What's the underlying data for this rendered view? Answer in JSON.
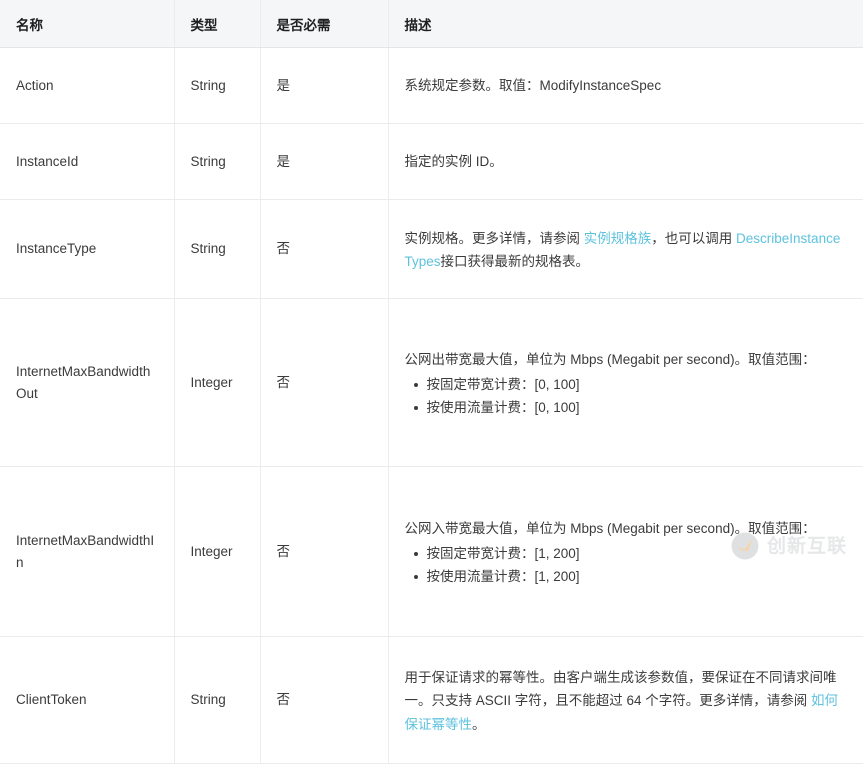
{
  "table": {
    "headers": [
      {
        "id": "name",
        "label": "名称"
      },
      {
        "id": "type",
        "label": "类型"
      },
      {
        "id": "required",
        "label": "是否必需"
      },
      {
        "id": "description",
        "label": "描述"
      }
    ],
    "rows": [
      {
        "name": "Action",
        "type": "String",
        "required": "是",
        "description": {
          "text": "系统规定参数。取值：ModifyInstanceSpec"
        }
      },
      {
        "name": "InstanceId",
        "type": "String",
        "required": "是",
        "description": {
          "text": "指定的实例 ID。"
        }
      },
      {
        "name": "InstanceType",
        "type": "String",
        "required": "否",
        "description": {
          "part1": "实例规格。更多详情，请参阅 ",
          "link1": "实例规格族",
          "part2": "，也可以调用 ",
          "link2": "DescribeInstanceTypes",
          "part3": "接口获得最新的规格表。"
        }
      },
      {
        "name": "InternetMaxBandwidthOut",
        "type": "Integer",
        "required": "否",
        "description": {
          "text": "公网出带宽最大值，单位为 Mbps (Megabit per second)。取值范围：",
          "bullets": [
            "按固定带宽计费：[0, 100]",
            "按使用流量计费：[0, 100]"
          ]
        }
      },
      {
        "name": "InternetMaxBandwidthIn",
        "type": "Integer",
        "required": "否",
        "description": {
          "text": "公网入带宽最大值，单位为 Mbps (Megabit per second)。取值范围：",
          "bullets": [
            "按固定带宽计费：[1, 200]",
            "按使用流量计费：[1, 200]"
          ]
        }
      },
      {
        "name": "ClientToken",
        "type": "String",
        "required": "否",
        "description": {
          "part1": "用于保证请求的幂等性。由客户端生成该参数值，要保证在不同请求间唯一。只支持 ASCII 字符，且不能超过 64 个字符。更多详情，请参阅 ",
          "link1": "如何保证幂等性",
          "part2": "。"
        }
      }
    ]
  },
  "watermark": {
    "text": "创新互联",
    "mark_icon": "check-circle-logo-icon",
    "mark_color": "#e8a33d",
    "circle_color": "#b9bbbd"
  },
  "colors": {
    "link": "#5cc2dd",
    "header_bg": "#f5f6f7",
    "border": "#eaebec",
    "text": "#3b3b3b"
  }
}
